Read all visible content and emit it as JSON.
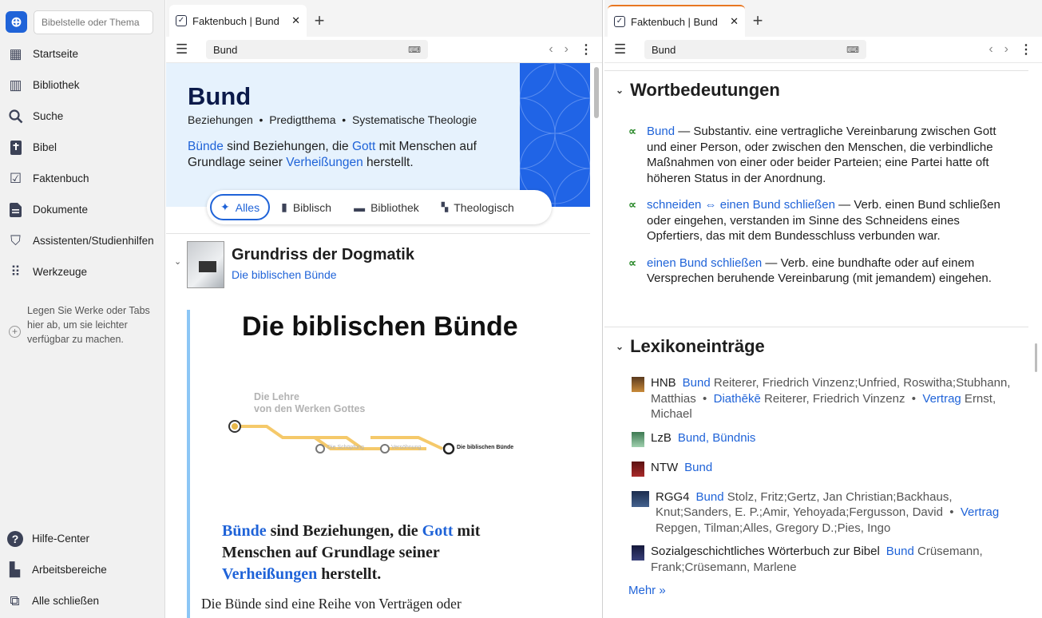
{
  "sidebar": {
    "search_placeholder": "Bibelstelle oder Thema",
    "items": [
      {
        "label": "Startseite",
        "icon": "dashboard-icon"
      },
      {
        "label": "Bibliothek",
        "icon": "library-icon"
      },
      {
        "label": "Suche",
        "icon": "search-icon"
      },
      {
        "label": "Bibel",
        "icon": "bible-icon"
      },
      {
        "label": "Faktenbuch",
        "icon": "factbook-icon"
      },
      {
        "label": "Dokumente",
        "icon": "document-icon"
      },
      {
        "label": "Assistenten/Studienhilfen",
        "icon": "assistant-icon"
      },
      {
        "label": "Werkzeuge",
        "icon": "tools-grid-icon"
      }
    ],
    "drop_hint": "Legen Sie Werke oder Tabs hier ab, um sie leichter verfügbar zu machen.",
    "bottom": [
      {
        "label": "Hilfe-Center",
        "icon": "help-icon"
      },
      {
        "label": "Arbeitsbereiche",
        "icon": "workspace-icon"
      },
      {
        "label": "Alle schließen",
        "icon": "close-all-icon"
      }
    ]
  },
  "left_pane": {
    "tab_title": "Faktenbuch | Bund",
    "address": "Bund",
    "title": "Bund",
    "crumbs": [
      "Beziehungen",
      "Predigtthema",
      "Systematische Theologie"
    ],
    "desc": {
      "l1": "Bünde",
      "t1": " sind Beziehungen, die ",
      "l2": "Gott",
      "t2": " mit Menschen auf Grundlage seiner ",
      "l3": "Verheißungen",
      "t3": " herstellt."
    },
    "filters": [
      "Alles",
      "Biblisch",
      "Bibliothek",
      "Theologisch"
    ],
    "book_title": "Grundriss der Dogmatik",
    "book_subtitle": "Die biblischen Bünde",
    "big_title": "Die biblischen Bünde",
    "diagram": {
      "heading1": "Die Lehre",
      "heading2": "von den Werken Gottes",
      "stop1": "Die Schöpfung",
      "stop2": "Versöhnung",
      "stop3": "Die biblischen Bünde"
    },
    "summary": {
      "l1": "Bünde",
      "t1": " sind Beziehungen, die ",
      "l2": "Gott",
      "t2": " mit Menschen auf Grundlage seiner ",
      "l3": "Verheißungen",
      "t3": " herstellt."
    },
    "body": "Die Bünde sind eine Reihe von Verträgen oder"
  },
  "right_pane": {
    "tab_title": "Faktenbuch | Bund",
    "address": "Bund",
    "section1": "Wortbedeutungen",
    "defs": [
      {
        "term": "Bund",
        "text": " — Substantiv. eine vertragliche Vereinbarung zwischen Gott und einer Person, oder zwischen den Menschen, die verbindliche Maßnahmen von einer oder beider Parteien; eine Partei hatte oft höheren Status in der Anordnung."
      },
      {
        "term": "schneiden ⇔ einen Bund schließen",
        "text": " — Verb. einen Bund schließen oder eingehen, verstanden im Sinne des Schneidens eines Opfertiers, das mit dem Bundesschluss verbunden war."
      },
      {
        "term": "einen Bund schließen",
        "text": " — Verb. eine bundhafte oder auf einem Versprechen beruhende Vereinbarung (mit jemandem) eingehen."
      }
    ],
    "section2": "Lexikoneinträge",
    "lex": {
      "r1": {
        "abbr": "HNB",
        "a": "Bund",
        "a_auth": " Reiterer, Friedrich Vinzenz;Unfried, Roswitha;Stubhann, Matthias",
        "b": "Diathēkē",
        "b_auth": " Reiterer, Friedrich Vinzenz",
        "c": "Vertrag",
        "c_auth": " Ernst, Michael"
      },
      "r2": {
        "abbr": "LzB",
        "a": "Bund, Bündnis"
      },
      "r3": {
        "abbr": "NTW",
        "a": "Bund"
      },
      "r4": {
        "abbr": "RGG4",
        "a": "Bund",
        "a_auth": " Stolz, Fritz;Gertz, Jan Christian;Backhaus, Knut;Sanders, E. P.;Amir, Yehoyada;Fergusson, David",
        "b": "Vertrag",
        "b_auth": " Repgen, Tilman;Alles, Gregory D.;Pies, Ingo"
      },
      "r5": {
        "abbr": "Sozialgeschichtliches Wörterbuch zur Bibel",
        "a": "Bund",
        "a_auth": " Crüsemann, Frank;Crüsemann, Marlene"
      }
    },
    "more": "Mehr »"
  },
  "colors": {
    "accent": "#1f63d8",
    "hero_bg": "#e6f2fd",
    "pattern": "#2064e6",
    "def_icon": "#2e8b2e",
    "tab_accent": "#e87722"
  }
}
